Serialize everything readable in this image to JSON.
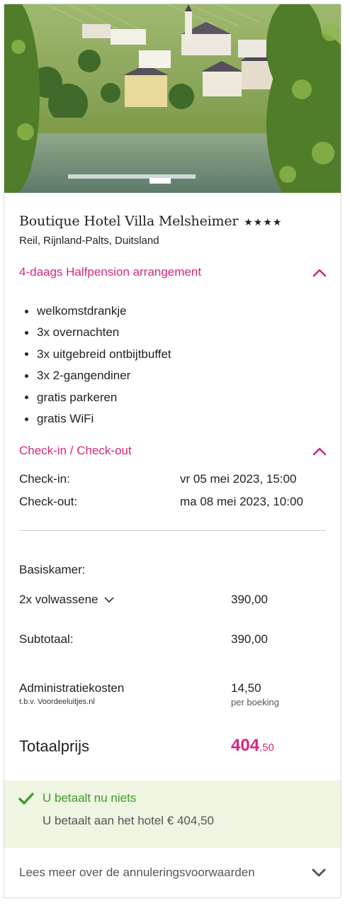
{
  "hotel": {
    "name": "Boutique Hotel Villa Melsheimer",
    "stars": "★★★★",
    "location": "Reil, Rijnland-Palts, Duitsland"
  },
  "arrangement": {
    "title": "4-daags Halfpension arrangement",
    "features": [
      "welkomstdrankje",
      "3x overnachten",
      "3x uitgebreid ontbijtbuffet",
      "3x 2-gangendiner",
      "gratis parkeren",
      "gratis WiFi"
    ]
  },
  "checkinout": {
    "title": "Check-in / Check-out",
    "checkin_label": "Check-in:",
    "checkin_value": "vr 05 mei 2023, 15:00",
    "checkout_label": "Check-out:",
    "checkout_value": "ma 08 mei 2023, 10:00"
  },
  "pricing": {
    "room_label": "Basiskamer:",
    "guests_select": "2x volwassene",
    "guests_amount": "390,00",
    "subtotal_label": "Subtotaal:",
    "subtotal_amount": "390,00",
    "admin_label": "Administratiekosten",
    "admin_sub": "t.b.v. Voordeeluitjes.nl",
    "admin_amount": "14,50",
    "admin_per": "per boeking",
    "total_label": "Totaalprijs",
    "total_whole": "404",
    "total_cents": ",50"
  },
  "payment": {
    "pay_now": "U betaalt nu niets",
    "pay_hotel": "U betaalt aan het hotel € 404,50"
  },
  "cancellation": {
    "link": "Lees meer over de annuleringsvoorwaarden"
  },
  "colors": {
    "accent": "#d6277f",
    "success": "#3f9a2b",
    "success_bg": "#eef5e0"
  },
  "icons": {
    "collapse": "chevron-up-icon",
    "dropdown": "chevron-down-icon",
    "check": "check-icon"
  }
}
